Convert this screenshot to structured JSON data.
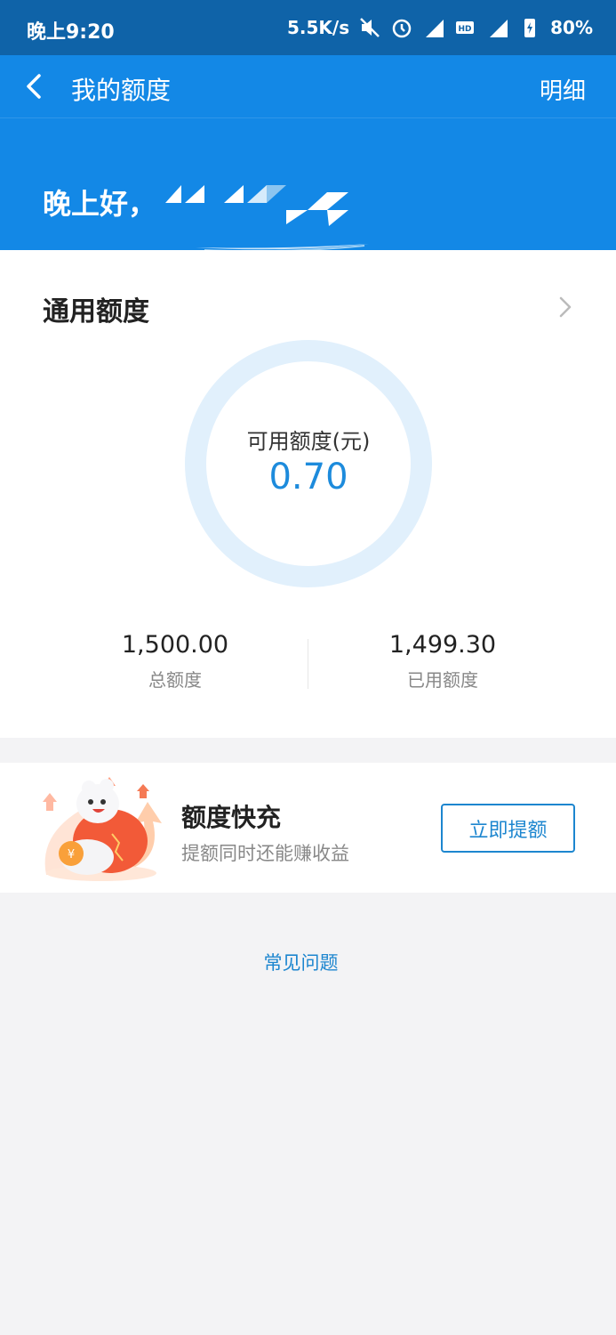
{
  "status_bar": {
    "time": "晚上9:20",
    "net_speed": "5.5K/s",
    "battery": "80%",
    "icons": [
      "mute-icon",
      "alarm-icon",
      "signal-4g-icon",
      "hd-icon",
      "signal-4g-icon",
      "battery-icon"
    ]
  },
  "header": {
    "title": "我的额度",
    "detail_link": "明细"
  },
  "hero": {
    "greeting": "晚上好，"
  },
  "credit_card": {
    "title": "通用额度",
    "available_label": "可用额度(元)",
    "available_value": "0.70",
    "total_value": "1,500.00",
    "total_label": "总额度",
    "used_value": "1,499.30",
    "used_label": "已用额度"
  },
  "promo": {
    "title": "额度快充",
    "subtitle": "提额同时还能赚收益",
    "button_label": "立即提额"
  },
  "faq": {
    "link_label": "常见问题"
  },
  "colors": {
    "status_bar": "#0f63a8",
    "header": "#1388e6",
    "accent": "#1d8bdc",
    "ring": "#e1f0fc",
    "background": "#f3f3f5"
  }
}
